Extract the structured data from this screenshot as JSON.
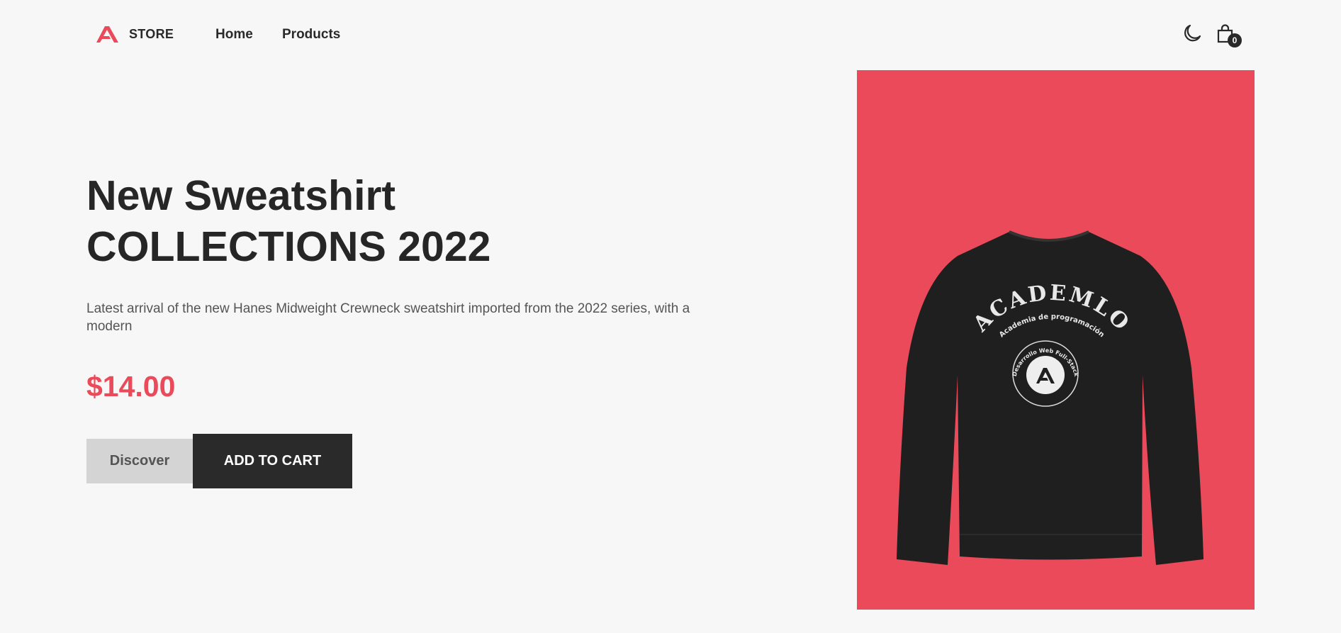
{
  "header": {
    "brand": "STORE",
    "logo_icon": "academlo-logo-icon",
    "nav": [
      {
        "label": "Home"
      },
      {
        "label": "Products"
      }
    ],
    "theme_toggle_icon": "moon-icon",
    "cart_icon": "shopping-bag-icon",
    "cart_count": "0"
  },
  "hero": {
    "title_line1": "New Sweatshirt",
    "title_line2": "COLLECTIONS 2022",
    "description": "Latest arrival of the new Hanes Midweight Crewneck sweatshirt imported from the 2022 series, with a modern",
    "price": "$14.00",
    "discover_label": "Discover",
    "add_to_cart_label": "ADD TO CART",
    "image_background": "#ea4a5a",
    "shirt_print": {
      "main": "ACADEMLO",
      "sub": "Academia de programación",
      "ring": "Desarrollo Web Full-Stack"
    }
  },
  "colors": {
    "accent": "#ea4a5a",
    "dark": "#2a2a2a",
    "background": "#f7f7f7"
  }
}
